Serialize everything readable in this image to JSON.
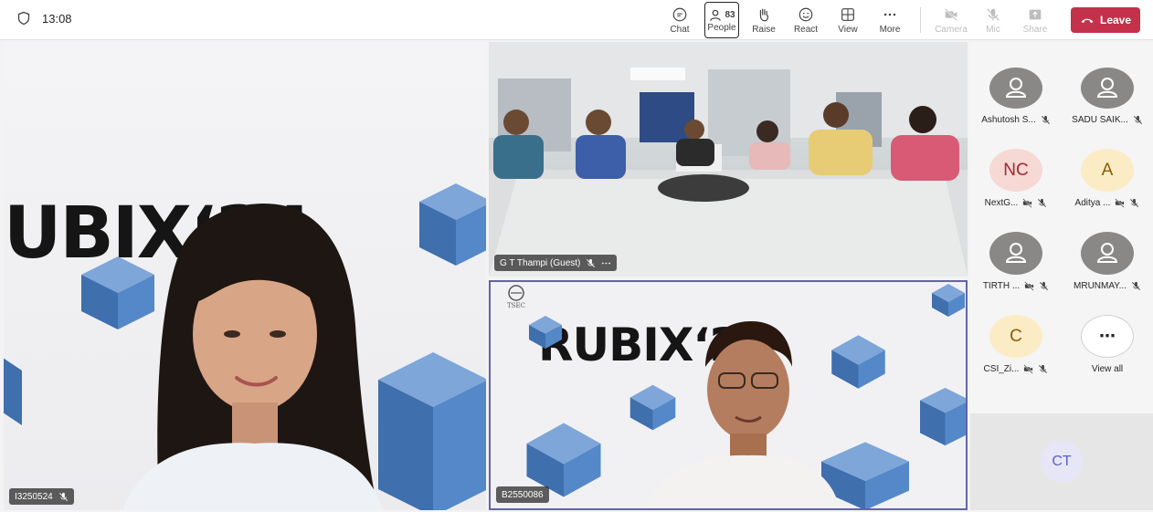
{
  "clock": {
    "time": "13:08",
    "icon": "shield-icon"
  },
  "toolbar": {
    "chat": "Chat",
    "people": "People",
    "people_count": "83",
    "raise": "Raise",
    "react": "React",
    "view": "View",
    "more": "More",
    "camera": "Camera",
    "mic": "Mic",
    "share": "Share",
    "leave": "Leave"
  },
  "tiles": {
    "main": {
      "name": "I3250524",
      "banner": "UBIX‘24"
    },
    "room": {
      "name": "G T Thampi (Guest)"
    },
    "second": {
      "name": "B2550086",
      "banner": "RUBIX‘24",
      "logo": "TSEC"
    }
  },
  "participants": [
    {
      "initials": "",
      "name": "Ashutosh S...",
      "style": "grey",
      "icons": [
        "mic-off-icon"
      ]
    },
    {
      "initials": "",
      "name": "SADU SAIK...",
      "style": "grey",
      "icons": [
        "mic-off-icon"
      ]
    },
    {
      "initials": "NC",
      "name": "NextG...",
      "style": "nc",
      "icons": [
        "camera-off-icon",
        "mic-off-icon"
      ]
    },
    {
      "initials": "A",
      "name": "Aditya ...",
      "style": "a",
      "icons": [
        "camera-off-icon",
        "mic-off-icon"
      ]
    },
    {
      "initials": "",
      "name": "TIRTH ...",
      "style": "grey",
      "icons": [
        "camera-off-icon",
        "mic-off-icon"
      ]
    },
    {
      "initials": "",
      "name": "MRUNMAY...",
      "style": "grey",
      "icons": [
        "mic-off-icon"
      ]
    },
    {
      "initials": "C",
      "name": "CSI_Zi...",
      "style": "c",
      "icons": [
        "camera-off-icon",
        "mic-off-icon"
      ]
    },
    {
      "initials": "⋯",
      "name": "View all",
      "style": "more",
      "icons": []
    }
  ],
  "self": {
    "initials": "CT"
  },
  "colors": {
    "leave": "#c4314b",
    "accent": "#6264a7",
    "cube": "#4a7fc1"
  }
}
